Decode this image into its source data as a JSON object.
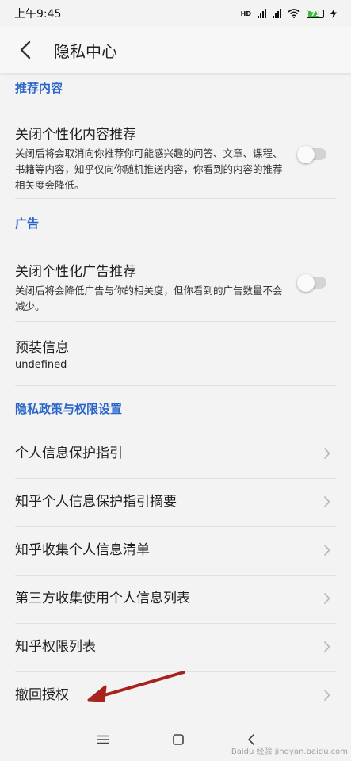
{
  "status": {
    "time": "上午9:45",
    "network": "HD",
    "battery": "71"
  },
  "header": {
    "title": "隐私中心"
  },
  "sections": {
    "recommend": "推荐内容",
    "ads": "广告",
    "policy": "隐私政策与权限设置"
  },
  "recommend_toggle": {
    "title": "关闭个性化内容推荐",
    "desc": "关闭后将会取消向你推荐你可能感兴趣的问答、文章、课程、书籍等内容，知乎仅向你随机推送内容，你看到的内容的推荐相关度会降低。",
    "on": false
  },
  "ad_toggle": {
    "title": "关闭个性化广告推荐",
    "desc": "关闭后将会降低广告与你的相关度，但你看到的广告数量不会减少。",
    "on": false
  },
  "preinstall": {
    "title": "预装信息",
    "value": "undefined"
  },
  "policy_items": [
    "个人信息保护指引",
    "知乎个人信息保护指引摘要",
    "知乎收集个人信息清单",
    "第三方收集使用个人信息列表",
    "知乎权限列表",
    "撤回授权"
  ],
  "annotation": {
    "arrow_color": "#a8231f"
  },
  "watermark": "Baidu 经验 jingyan.baidu.com"
}
